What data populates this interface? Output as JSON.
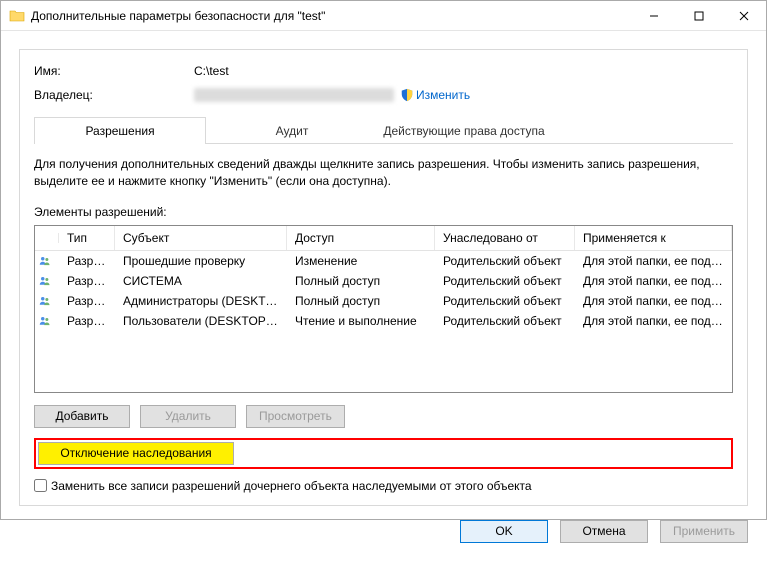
{
  "window": {
    "title": "Дополнительные параметры безопасности  для \"test\""
  },
  "info": {
    "name_label": "Имя:",
    "name_value": "C:\\test",
    "owner_label": "Владелец:",
    "change_link": "Изменить"
  },
  "tabs": {
    "permissions": "Разрешения",
    "audit": "Аудит",
    "effective": "Действующие права доступа"
  },
  "hint": "Для получения дополнительных сведений дважды щелкните запись разрешения. Чтобы изменить запись разрешения, выделите ее и нажмите кнопку \"Изменить\" (если она доступна).",
  "list_label": "Элементы разрешений:",
  "columns": {
    "type": "Тип",
    "subject": "Субъект",
    "access": "Доступ",
    "inherited": "Унаследовано от",
    "applies": "Применяется к"
  },
  "rows": [
    {
      "type": "Разр…",
      "subject": "Прошедшие проверку",
      "access": "Изменение",
      "inherited": "Родительский объект",
      "applies": "Для этой папки, ее подпапок …"
    },
    {
      "type": "Разр…",
      "subject": "СИСТЕМА",
      "access": "Полный доступ",
      "inherited": "Родительский объект",
      "applies": "Для этой папки, ее подпапок …"
    },
    {
      "type": "Разр…",
      "subject": "Администраторы (DESKTOP-…",
      "access": "Полный доступ",
      "inherited": "Родительский объект",
      "applies": "Для этой папки, ее подпапок …"
    },
    {
      "type": "Разр…",
      "subject": "Пользователи (DESKTOP-MO…",
      "access": "Чтение и выполнение",
      "inherited": "Родительский объект",
      "applies": "Для этой папки, ее подпапок …"
    }
  ],
  "buttons": {
    "add": "Добавить",
    "remove": "Удалить",
    "view": "Просмотреть",
    "disable_inherit": "Отключение наследования",
    "ok": "OK",
    "cancel": "Отмена",
    "apply": "Применить"
  },
  "checkbox": {
    "label": "Заменить все записи разрешений дочернего объекта наследуемыми от этого объекта"
  }
}
